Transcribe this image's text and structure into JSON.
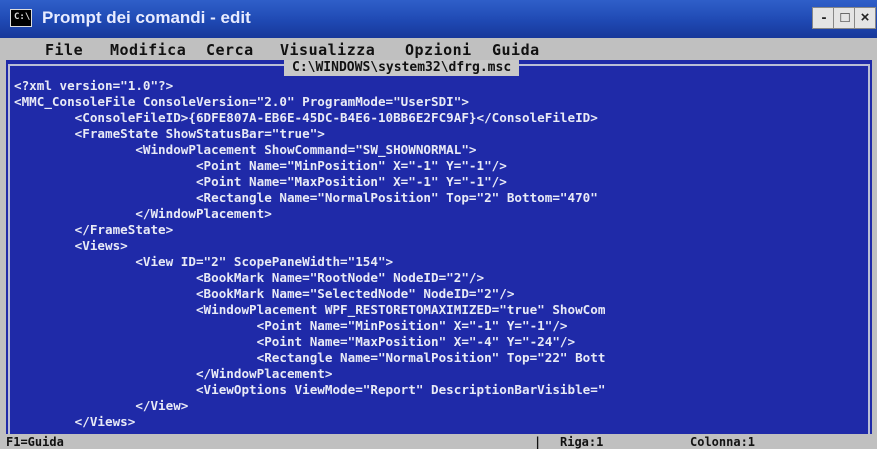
{
  "window": {
    "title": "Prompt dei comandi - edit",
    "controls": {
      "minimize": "-",
      "maximize": "□",
      "close": "×"
    }
  },
  "menu": {
    "items": [
      "File",
      "Modifica",
      "Cerca",
      "Visualizza",
      "Opzioni",
      "Guida"
    ]
  },
  "editor": {
    "file_path": "C:\\WINDOWS\\system32\\dfrg.msc",
    "lines": [
      "<?xml version=\"1.0\"?>",
      "<MMC_ConsoleFile ConsoleVersion=\"2.0\" ProgramMode=\"UserSDI\">",
      "        <ConsoleFileID>{6DFE807A-EB6E-45DC-B4E6-10BB6E2FC9AF}</ConsoleFileID>",
      "        <FrameState ShowStatusBar=\"true\">",
      "                <WindowPlacement ShowCommand=\"SW_SHOWNORMAL\">",
      "                        <Point Name=\"MinPosition\" X=\"-1\" Y=\"-1\"/>",
      "                        <Point Name=\"MaxPosition\" X=\"-1\" Y=\"-1\"/>",
      "                        <Rectangle Name=\"NormalPosition\" Top=\"2\" Bottom=\"470\"",
      "                </WindowPlacement>",
      "        </FrameState>",
      "        <Views>",
      "                <View ID=\"2\" ScopePaneWidth=\"154\">",
      "                        <BookMark Name=\"RootNode\" NodeID=\"2\"/>",
      "                        <BookMark Name=\"SelectedNode\" NodeID=\"2\"/>",
      "                        <WindowPlacement WPF_RESTORETOMAXIMIZED=\"true\" ShowCom",
      "                                <Point Name=\"MinPosition\" X=\"-1\" Y=\"-1\"/>",
      "                                <Point Name=\"MaxPosition\" X=\"-4\" Y=\"-24\"/>",
      "                                <Rectangle Name=\"NormalPosition\" Top=\"22\" Bott",
      "                        </WindowPlacement>",
      "                        <ViewOptions ViewMode=\"Report\" DescriptionBarVisible=\"",
      "                </View>",
      "        </Views>"
    ]
  },
  "status": {
    "help": "F1=Guida",
    "row": "Riga:1",
    "column": "Colonna:1"
  },
  "colors": {
    "editor_background": "#1f2aa8",
    "editor_text": "#e8eaf6",
    "titlebar": "#2f5fc9",
    "chrome": "#c0c0c0"
  },
  "icons": [
    "console-icon",
    "minimize-icon",
    "maximize-icon",
    "close-icon"
  ]
}
